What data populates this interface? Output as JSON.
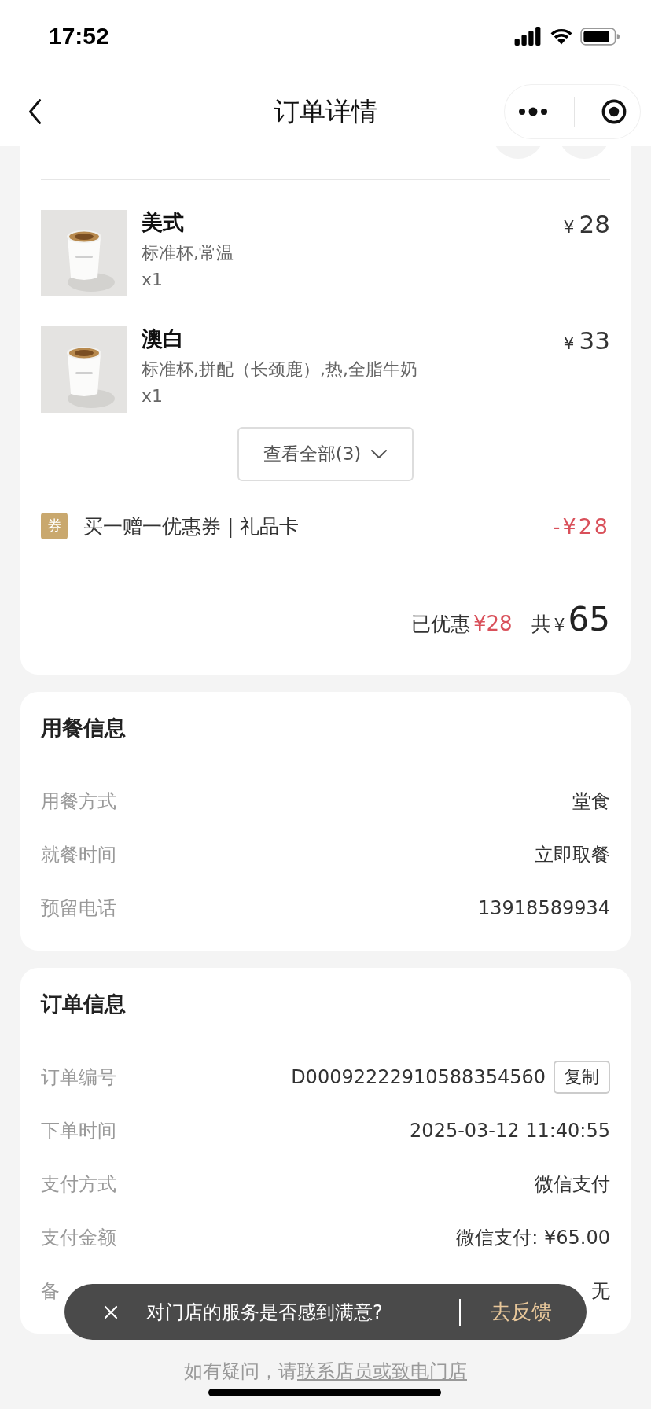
{
  "status_bar": {
    "time": "17:52"
  },
  "nav": {
    "title": "订单详情"
  },
  "items": [
    {
      "name": "美式",
      "options": "标准杯,常温",
      "quantity": "x1",
      "currency": "¥",
      "price": "28"
    },
    {
      "name": "澳白",
      "options": "标准杯,拼配（长颈鹿）,热,全脂牛奶",
      "quantity": "x1",
      "currency": "¥",
      "price": "33"
    }
  ],
  "view_all": "查看全部(3)",
  "coupon": {
    "badge": "券",
    "label": "买一赠一优惠券 | 礼品卡",
    "amount": "-¥28"
  },
  "summary": {
    "discount_label": "已优惠",
    "discount": "¥28",
    "total_label": "共",
    "currency": "¥",
    "total": "65"
  },
  "dining_info": {
    "title": "用餐信息",
    "rows": [
      {
        "label": "用餐方式",
        "value": "堂食"
      },
      {
        "label": "就餐时间",
        "value": "立即取餐"
      },
      {
        "label": "预留电话",
        "value": "13918589934"
      }
    ]
  },
  "order_info": {
    "title": "订单信息",
    "rows": [
      {
        "label": "订单编号",
        "value": "D00092222910588354560",
        "action": "复制"
      },
      {
        "label": "下单时间",
        "value": "2025-03-12 11:40:55"
      },
      {
        "label": "支付方式",
        "value": "微信支付"
      },
      {
        "label": "支付金额",
        "value": "微信支付: ¥65.00"
      },
      {
        "label": "备",
        "value": "无"
      }
    ]
  },
  "toast": {
    "message": "对门店的服务是否感到满意?",
    "action": "去反馈"
  },
  "footer": {
    "text": "如有疑问，请",
    "link": "联系店员或致电门店"
  }
}
